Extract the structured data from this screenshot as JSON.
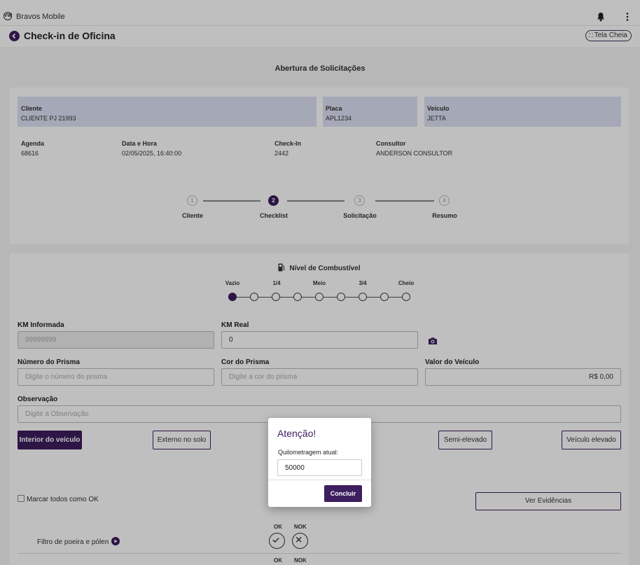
{
  "app": {
    "brand": "Bravos Mobile",
    "logo_letters": "VW"
  },
  "header": {
    "title": "Check-in de Oficina",
    "fullscreen_label": "Tela Cheia"
  },
  "section_heading": "Abertura de Solicitações",
  "summary": {
    "cliente": {
      "label": "Cliente",
      "value": "CLIENTE PJ 21993"
    },
    "placa": {
      "label": "Placa",
      "value": "APL1234"
    },
    "veiculo": {
      "label": "Veículo",
      "value": "JETTA"
    },
    "agenda": {
      "label": "Agenda",
      "value": "68616"
    },
    "data_hora": {
      "label": "Data e Hora",
      "value": "02/05/2025, 16:40:00"
    },
    "checkin": {
      "label": "Check-In",
      "value": "2442"
    },
    "consultor": {
      "label": "Consultor",
      "value": "ANDERSON CONSULTOR"
    }
  },
  "stepper": {
    "current": 2,
    "steps": [
      {
        "number": "1",
        "label": "Cliente"
      },
      {
        "number": "2",
        "label": "Checklist"
      },
      {
        "number": "3",
        "label": "Solicitação"
      },
      {
        "number": "4",
        "label": "Resumo"
      }
    ]
  },
  "fuel": {
    "title": "Nível de Combustível",
    "labels": [
      "Vazio",
      "1/4",
      "Meio",
      "3/4",
      "Cheio"
    ],
    "positions": 9,
    "selected_index": 0
  },
  "form": {
    "km_informada": {
      "label": "KM Informada",
      "placeholder": "99999999"
    },
    "km_real": {
      "label": "KM Real",
      "value": "0"
    },
    "numero_prisma": {
      "label": "Número do Prisma",
      "placeholder": "Digite o número do prisma"
    },
    "cor_prisma": {
      "label": "Cor do Prisma",
      "placeholder": "Digite a cor do prisma"
    },
    "valor_veiculo": {
      "label": "Valor do Veículo",
      "value": "R$ 0,00"
    },
    "observacao": {
      "label": "Observação",
      "placeholder": "Digite a Observação"
    }
  },
  "view_buttons": {
    "interior": "Interior do veículo",
    "externo": "Externo no solo",
    "semi": "Semi-elevado",
    "elevado": "Veículo elevado"
  },
  "checklist": {
    "mark_all_label": "Marcar todos como OK",
    "evidence_button": "Ver Evidências",
    "ok_label": "OK",
    "nok_label": "NOK",
    "items": [
      {
        "label": "Filtro de poeira e pólen"
      }
    ]
  },
  "modal": {
    "title": "Atenção!",
    "field_label": "Quilometragem atual:",
    "field_value": "50000",
    "confirm_label": "Concluir"
  },
  "colors": {
    "accent": "#3d1e5e",
    "info_box": "#dde2f4"
  },
  "icons": [
    "vw-logo-icon",
    "bell-icon",
    "kebab-icon",
    "back-arrow-icon",
    "fullscreen-icon",
    "fuel-pump-icon",
    "camera-icon",
    "play-circle-icon",
    "check-icon",
    "close-icon"
  ]
}
